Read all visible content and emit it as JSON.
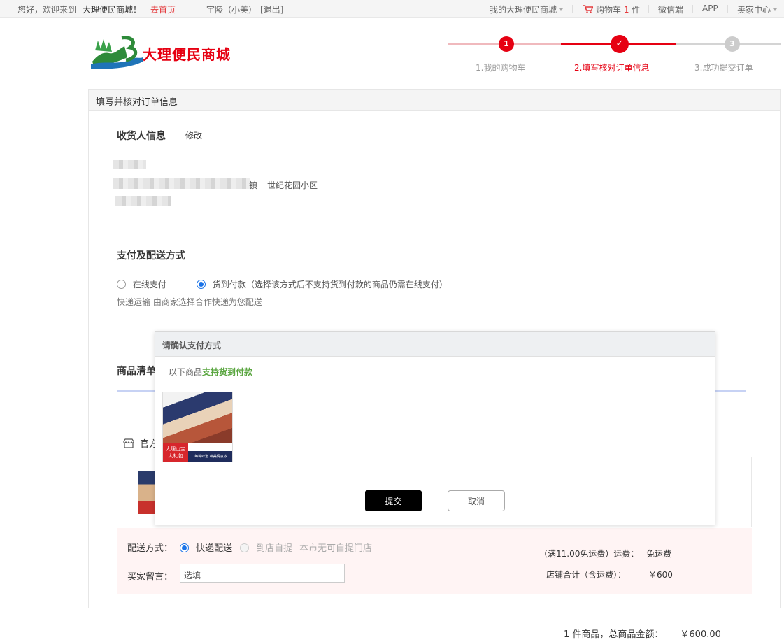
{
  "topbar": {
    "welcome": "您好，欢迎来到",
    "site_name": "大理便民商城！",
    "home_link": "去首页",
    "user": "宇陵（小美）",
    "logout": "[退出]",
    "my_mall": "我的大理便民商城",
    "cart_label": "购物车",
    "cart_count": "1",
    "cart_unit": "件",
    "wechat": "微信端",
    "app": "APP",
    "seller": "卖家中心"
  },
  "logo": {
    "text": "大理便民商城"
  },
  "steps": [
    {
      "num": "1",
      "label": "1.我的购物车"
    },
    {
      "num": "✓",
      "label": "2.填写核对订单信息"
    },
    {
      "num": "3",
      "label": "3.成功提交订单"
    }
  ],
  "panel": {
    "title": "填写并核对订单信息"
  },
  "receiver": {
    "title": "收货人信息",
    "edit": "修改",
    "addr_suffix_1": "镇",
    "addr_suffix_2": "世纪花园小区"
  },
  "payment": {
    "title": "支付及配送方式",
    "online": "在线支付",
    "cod": "货到付款（选择该方式后不支持货到付款的商品仍需在线支付）",
    "delivery_note": "快递运输 由商家选择合作快递为您配送",
    "selected": "货到付款"
  },
  "goods": {
    "title_visible": "商品清单",
    "store_visible": "官方"
  },
  "shipping": {
    "method_label": "配送方式：",
    "express": "快递配送",
    "pickup": "到店自提",
    "pickup_note": "本市无可自提门店",
    "message_label": "买家留言：",
    "message_placeholder": "选填",
    "freight_label": "（满11.00免运费）运费：",
    "freight_value": "免运费",
    "store_total_label": "店铺合计（含运费）：",
    "store_total_value": "￥600"
  },
  "modal": {
    "title": "请确认支付方式",
    "msg_prefix": "以下商品",
    "msg_highlight": "支持货到付款",
    "product_label_1": "大理山宝",
    "product_label_2": "大礼包",
    "product_tag": "每种味道 味美情意浓",
    "submit": "提交",
    "cancel": "取消"
  },
  "summary": {
    "text": "1 件商品，总商品金额：",
    "amount": "￥600.00"
  },
  "colors": {
    "brand_red": "#e60012",
    "accent_blue": "#1a73e8",
    "green": "#5aa640"
  }
}
